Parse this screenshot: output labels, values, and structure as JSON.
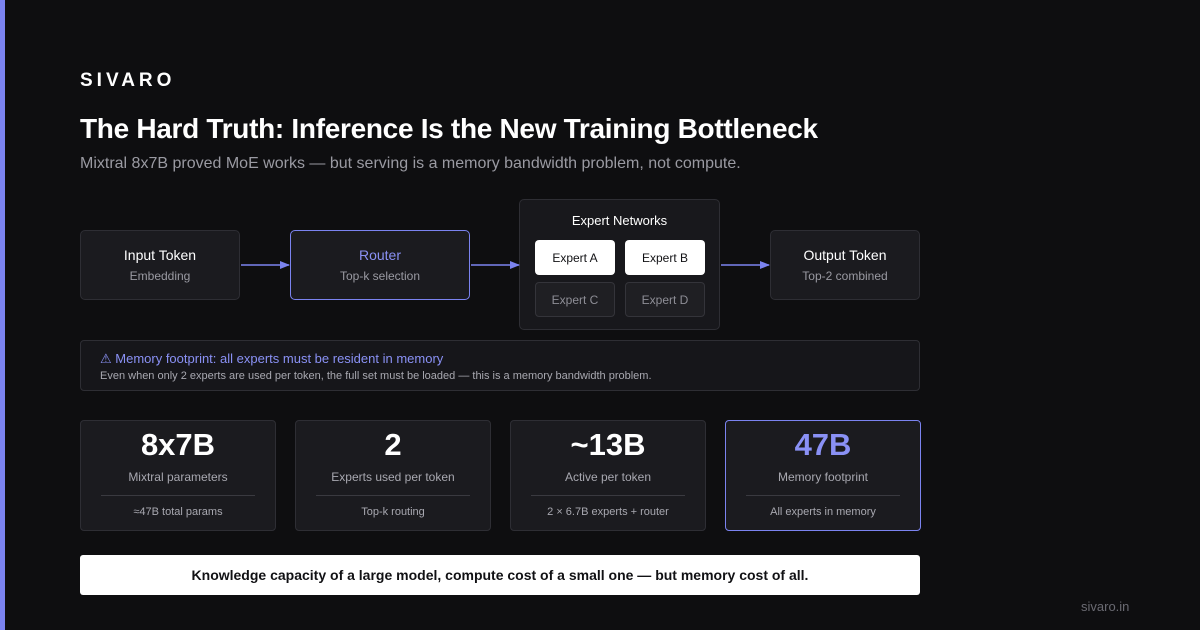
{
  "brand": "SIVARO",
  "title": "The Hard Truth: Inference Is the New Training Bottleneck",
  "subtitle": "Mixtral 8x7B proved MoE works — but serving is a memory bandwidth problem, not compute.",
  "diagram": {
    "input": {
      "title": "Input Token",
      "sub": "Embedding"
    },
    "router": {
      "title": "Router",
      "sub": "Top-k selection"
    },
    "experts": {
      "title": "Expert Networks",
      "items": [
        {
          "label": "Expert A",
          "active": true
        },
        {
          "label": "Expert B",
          "active": true
        },
        {
          "label": "Expert C",
          "active": false
        },
        {
          "label": "Expert D",
          "active": false
        }
      ]
    },
    "output": {
      "title": "Output Token",
      "sub": "Top-2 combined"
    },
    "arrow_color": "#7b83f0"
  },
  "callout": {
    "icon": "warning-icon",
    "heading": "⚠ Memory footprint: all experts must be resident in memory",
    "body": "Even when only 2 experts are used per token, the full set must be loaded — this is a memory bandwidth problem."
  },
  "stats": [
    {
      "value": "8x7B",
      "label": "Mixtral parameters",
      "note": "≈47B total params",
      "highlight": false
    },
    {
      "value": "2",
      "label": "Experts used per token",
      "note": "Top-k routing",
      "highlight": false
    },
    {
      "value": "~13B",
      "label": "Active per token",
      "note": "2 × 6.7B experts + router",
      "highlight": false
    },
    {
      "value": "47B",
      "label": "Memory footprint",
      "note": "All experts in memory",
      "highlight": true
    }
  ],
  "banner": "Knowledge capacity of a large model, compute cost of a small one — but memory cost of all.",
  "footer_url": "sivaro.in",
  "colors": {
    "accent": "#7b83f0",
    "background": "#0e0e10",
    "card": "#1b1b1f",
    "border": "#2e2e34"
  }
}
